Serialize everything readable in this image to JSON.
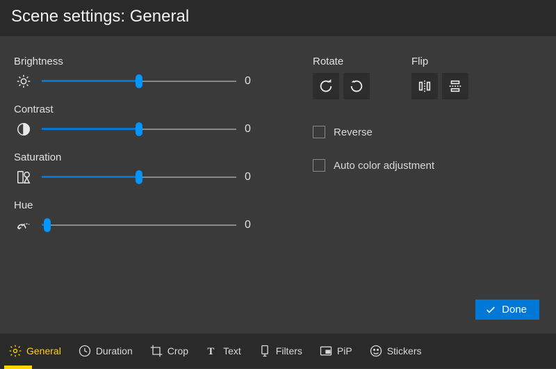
{
  "header": {
    "title": "Scene settings: General"
  },
  "sliders": {
    "brightness": {
      "label": "Brightness",
      "value": 0,
      "position": 50,
      "fill": 50
    },
    "contrast": {
      "label": "Contrast",
      "value": 0,
      "position": 50,
      "fill": 50
    },
    "saturation": {
      "label": "Saturation",
      "value": 0,
      "position": 50,
      "fill": 50
    },
    "hue": {
      "label": "Hue",
      "value": 0,
      "position": 3,
      "fill": 3
    }
  },
  "rotate": {
    "label": "Rotate"
  },
  "flip": {
    "label": "Flip"
  },
  "checkboxes": {
    "reverse": {
      "label": "Reverse",
      "checked": false
    },
    "autocolor": {
      "label": "Auto color adjustment",
      "checked": false
    }
  },
  "buttons": {
    "done": "Done"
  },
  "tabs": [
    {
      "id": "general",
      "label": "General",
      "active": true
    },
    {
      "id": "duration",
      "label": "Duration",
      "active": false
    },
    {
      "id": "crop",
      "label": "Crop",
      "active": false
    },
    {
      "id": "text",
      "label": "Text",
      "active": false
    },
    {
      "id": "filters",
      "label": "Filters",
      "active": false
    },
    {
      "id": "pip",
      "label": "PiP",
      "active": false
    },
    {
      "id": "stickers",
      "label": "Stickers",
      "active": false
    }
  ]
}
